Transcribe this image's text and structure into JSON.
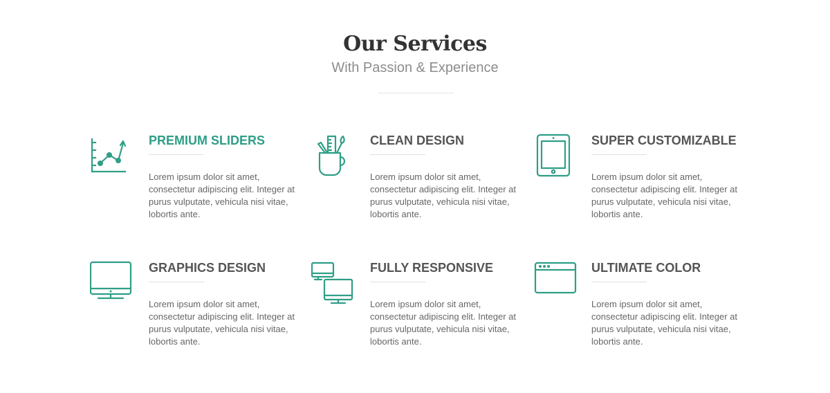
{
  "header": {
    "title": "Our Services",
    "subtitle": "With Passion & Experience"
  },
  "accent_color": "#2f9e86",
  "services": [
    {
      "icon": "chart-icon",
      "title": "Premium Sliders",
      "text": "Lorem ipsum dolor sit amet, consectetur adipiscing elit. Integer at purus vulputate, vehicula nisi vitae, lobortis ante."
    },
    {
      "icon": "design-tools-icon",
      "title": "Clean Design",
      "text": "Lorem ipsum dolor sit amet, consectetur adipiscing elit. Integer at purus vulputate, vehicula nisi vitae, lobortis ante."
    },
    {
      "icon": "tablet-icon",
      "title": "Super Customizable",
      "text": "Lorem ipsum dolor sit amet, consectetur adipiscing elit. Integer at purus vulputate, vehicula nisi vitae, lobortis ante."
    },
    {
      "icon": "monitor-icon",
      "title": "Graphics Design",
      "text": "Lorem ipsum dolor sit amet, consectetur adipiscing elit. Integer at purus vulputate, vehicula nisi vitae, lobortis ante."
    },
    {
      "icon": "responsive-devices-icon",
      "title": "Fully Responsive",
      "text": "Lorem ipsum dolor sit amet, consectetur adipiscing elit. Integer at purus vulputate, vehicula nisi vitae, lobortis ante."
    },
    {
      "icon": "browser-window-icon",
      "title": "Ultimate Color",
      "text": "Lorem ipsum dolor sit amet, consectetur adipiscing elit. Integer at purus vulputate, vehicula nisi vitae, lobortis ante."
    }
  ]
}
